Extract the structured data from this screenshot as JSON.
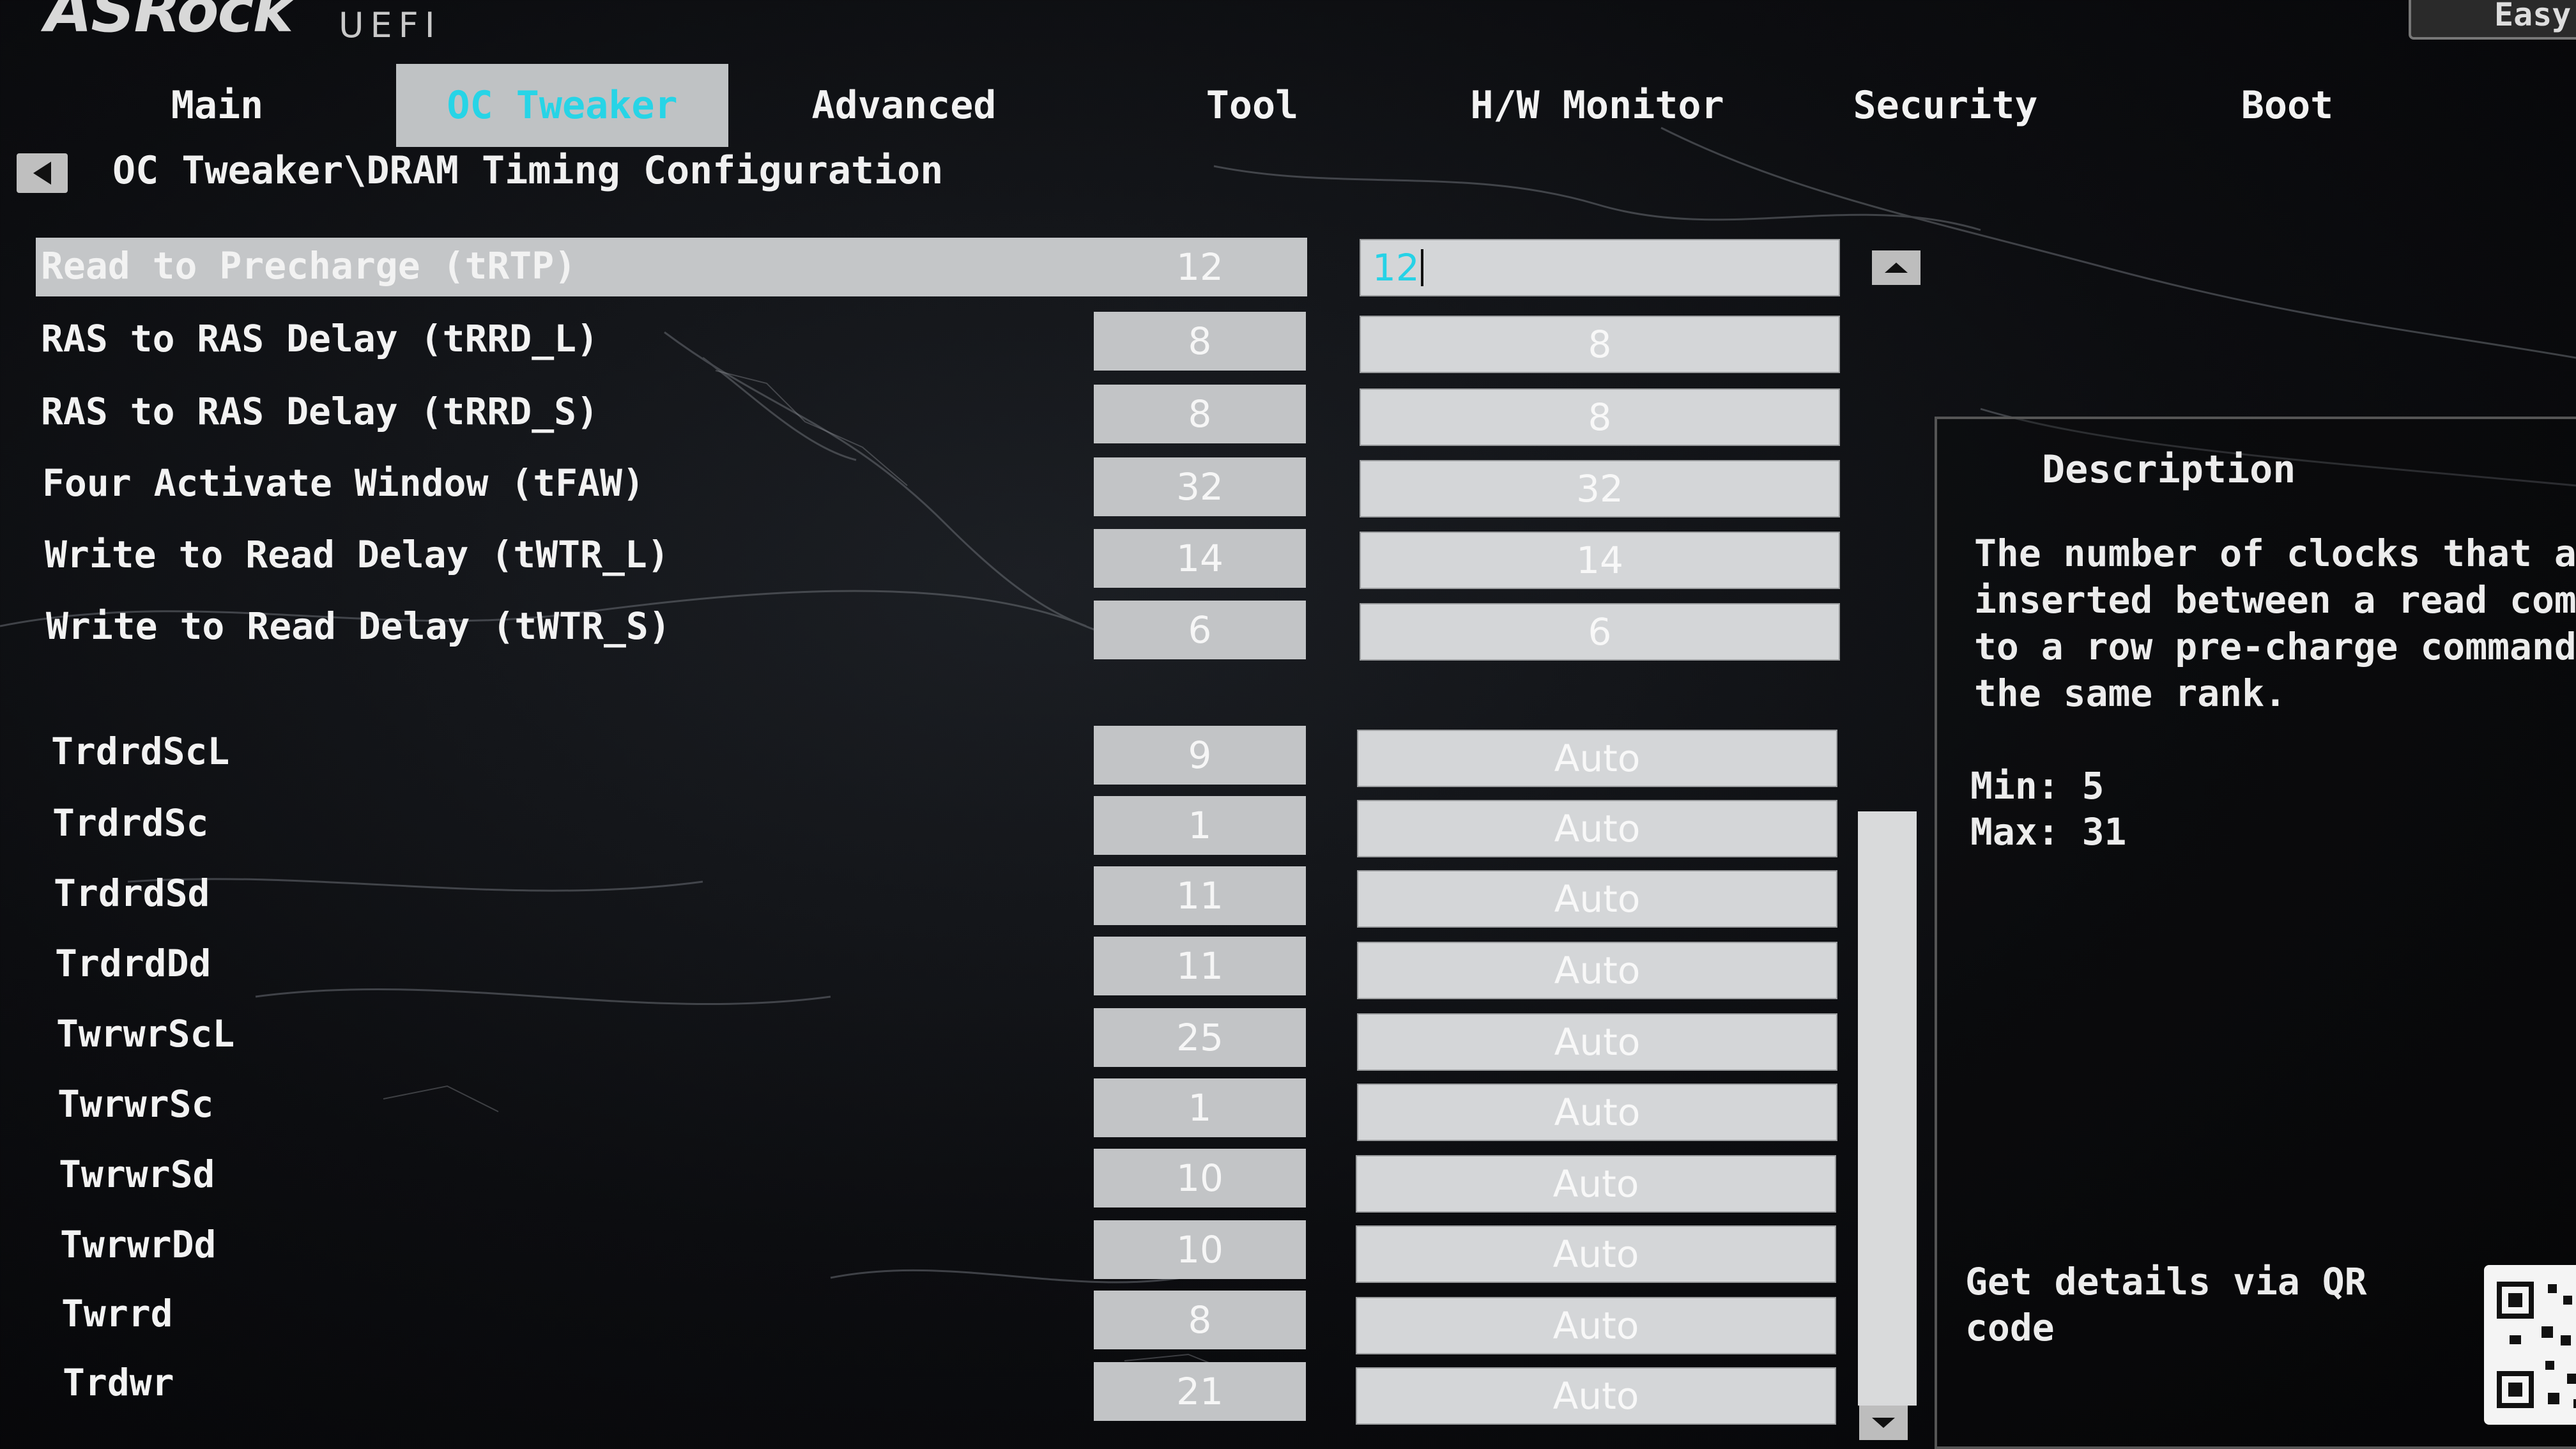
{
  "brand": {
    "logo": "ASRock",
    "subtitle": "UEFI",
    "mode_button": "Easy"
  },
  "tabs": [
    {
      "label": "Main"
    },
    {
      "label": "OC Tweaker"
    },
    {
      "label": "Advanced"
    },
    {
      "label": "Tool"
    },
    {
      "label": "H/W Monitor"
    },
    {
      "label": "Security"
    },
    {
      "label": "Boot"
    }
  ],
  "active_tab": "OC Tweaker",
  "breadcrumb": "OC Tweaker\\DRAM Timing Configuration",
  "rows": [
    {
      "label": "Read to Precharge (tRTP)",
      "current": "12",
      "setting": "12"
    },
    {
      "label": "RAS to RAS Delay (tRRD_L)",
      "current": "8",
      "setting": "8"
    },
    {
      "label": "RAS to RAS Delay (tRRD_S)",
      "current": "8",
      "setting": "8"
    },
    {
      "label": "Four Activate Window (tFAW)",
      "current": "32",
      "setting": "32"
    },
    {
      "label": "Write to Read Delay (tWTR_L)",
      "current": "14",
      "setting": "14"
    },
    {
      "label": "Write to Read Delay (tWTR_S)",
      "current": "6",
      "setting": "6"
    },
    {
      "label": "TrdrdScL",
      "current": "9",
      "setting": "Auto"
    },
    {
      "label": "TrdrdSc",
      "current": "1",
      "setting": "Auto"
    },
    {
      "label": "TrdrdSd",
      "current": "11",
      "setting": "Auto"
    },
    {
      "label": "TrdrdDd",
      "current": "11",
      "setting": "Auto"
    },
    {
      "label": "TwrwrScL",
      "current": "25",
      "setting": "Auto"
    },
    {
      "label": "TwrwrSc",
      "current": "1",
      "setting": "Auto"
    },
    {
      "label": "TwrwrSd",
      "current": "10",
      "setting": "Auto"
    },
    {
      "label": "TwrwrDd",
      "current": "10",
      "setting": "Auto"
    },
    {
      "label": "Twrrd",
      "current": "8",
      "setting": "Auto"
    },
    {
      "label": "Trdwr",
      "current": "21",
      "setting": "Auto"
    }
  ],
  "description": {
    "title": "Description",
    "text": "The number of clocks that a\ninserted between a read com\nto a row pre-charge command\nthe same rank.",
    "min": "Min: 5",
    "max": "Max: 31",
    "qr_text": "Get details via QR\ncode"
  },
  "colors": {
    "accent": "#27d4e6",
    "field": "#d4d6d8",
    "highlight": "#c4c6c8"
  }
}
